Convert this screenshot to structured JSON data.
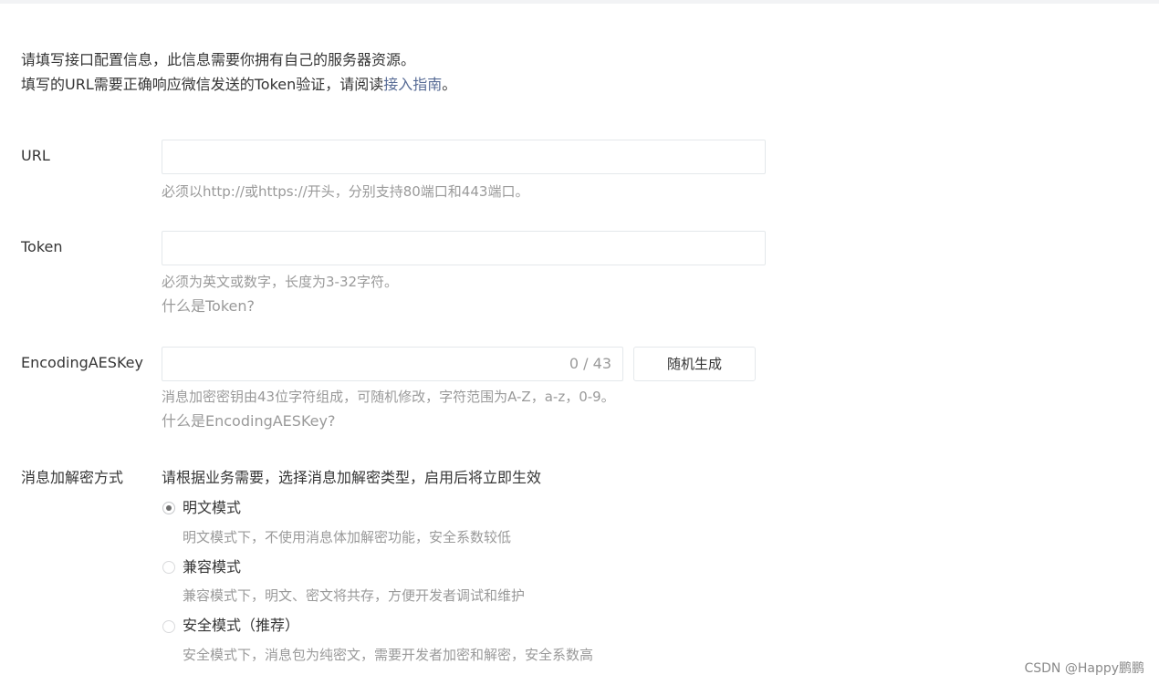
{
  "intro": {
    "line1": "请填写接口配置信息，此信息需要你拥有自己的服务器资源。",
    "line2_prefix": "填写的URL需要正确响应微信发送的Token验证，请阅读",
    "line2_link": "接入指南",
    "line2_suffix": "。"
  },
  "url": {
    "label": "URL",
    "value": "",
    "tip": "必须以http://或https://开头，分别支持80端口和443端口。"
  },
  "token": {
    "label": "Token",
    "value": "",
    "tip": "必须为英文或数字，长度为3-32字符。",
    "help_link": "什么是Token?"
  },
  "aeskey": {
    "label": "EncodingAESKey",
    "value": "",
    "counter": "0 / 43",
    "generate_button": "随机生成",
    "tip": "消息加密密钥由43位字符组成，可随机修改，字符范围为A-Z，a-z，0-9。",
    "help_link": "什么是EncodingAESKey?"
  },
  "encryption": {
    "label": "消息加解密方式",
    "prompt": "请根据业务需要，选择消息加解密类型，启用后将立即生效",
    "options": [
      {
        "label": "明文模式",
        "desc": "明文模式下，不使用消息体加解密功能，安全系数较低",
        "checked": true
      },
      {
        "label": "兼容模式",
        "desc": "兼容模式下，明文、密文将共存，方便开发者调试和维护",
        "checked": false
      },
      {
        "label": "安全模式（推荐）",
        "desc": "安全模式下，消息包为纯密文，需要开发者加密和解密，安全系数高",
        "checked": false
      }
    ]
  },
  "watermark": "CSDN @Happy鹏鹏"
}
